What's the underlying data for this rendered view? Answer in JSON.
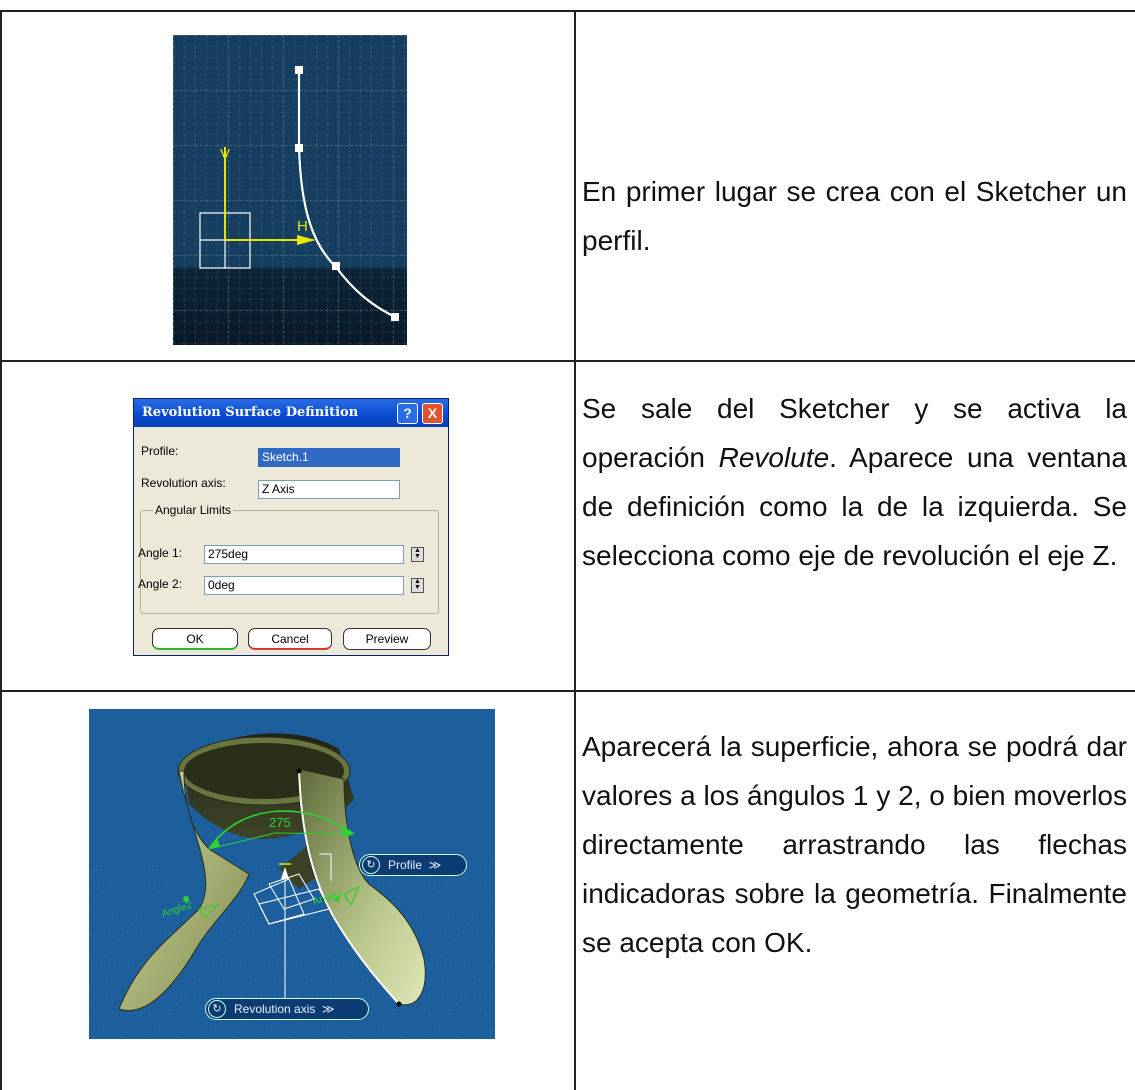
{
  "rows": [
    {
      "text": "En primer lugar se crea con el Sketcher un perfil.",
      "sketch": {
        "v_label": "V",
        "h_label": "H"
      }
    },
    {
      "text_before": "Se sale del Sketcher y se activa la operación ",
      "text_italic": "Revolute",
      "text_after": ". Aparece una ventana de definición como la de la izquierda. Se selecciona como eje de revolución el eje Z.",
      "dialog": {
        "title": "Revolution Surface Definition",
        "help_button": "?",
        "close_button": "X",
        "profile_label": "Profile:",
        "profile_value": "Sketch.1",
        "axis_label": "Revolution axis:",
        "axis_value": "Z Axis",
        "group_label": "Angular Limits",
        "angle1_label": "Angle 1:",
        "angle1_value": "275deg",
        "angle2_label": "Angle 2:",
        "angle2_value": "0deg",
        "ok_label": "OK",
        "cancel_label": "Cancel",
        "preview_label": "Preview"
      }
    },
    {
      "text": "Aparecerá la superficie, ahora se podrá dar valores a los ángulos 1 y 2, o bien moverlos directamente arrastrando las flechas indicadoras sobre la geometría. Finalmente se acepta con OK.",
      "viewport": {
        "angle_dim": "275",
        "profile_badge": "Profile",
        "axis_badge": "Revolution axis",
        "badge_arrow": "≫",
        "angle2_tag": "Angle2",
        "angle1_tag": "Angle1"
      }
    }
  ],
  "colors": {
    "sketch_bg": "#133a5a",
    "viewport_bg": "#1d5f9c",
    "dialog_bg": "#ece9d8",
    "titlebar": "#0a4ad0",
    "close_red": "#e2542d",
    "sketch_axis": "#e6e600",
    "dimension_green": "#2fd12f"
  }
}
